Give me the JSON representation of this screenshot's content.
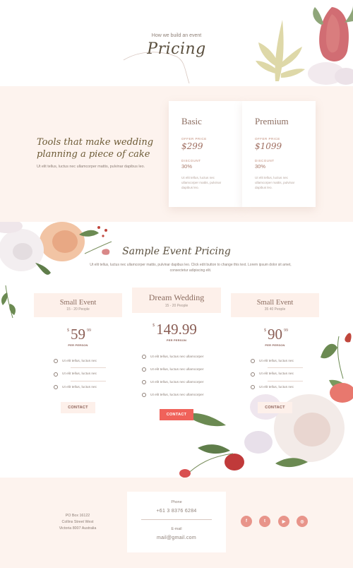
{
  "hero": {
    "kicker": "How we build an event",
    "title": "Pricing"
  },
  "tools": {
    "title": "Tools that make wedding planning a piece of cake",
    "description": "Ut elit tellus, luctus nec ullamcorper mattis, pulvinar dapibus leo."
  },
  "cards": [
    {
      "title": "Basic",
      "offer_label": "OFFER PRICE",
      "price": "$299",
      "discount_label": "DISCOUNT",
      "discount": "30%",
      "description": "Ut elit tellus, luctus nec ullamcorper mattis, pulvinar dapibus leo."
    },
    {
      "title": "Premium",
      "offer_label": "OFFER PRICE",
      "price": "$1099",
      "discount_label": "DISCOUNT",
      "discount": "30%",
      "description": "Ut elit tellus, luctus nec ullamcorper mattis, pulvinar dapibus leo."
    }
  ],
  "sample": {
    "title": "Sample Event Pricing",
    "description": "Ut elit tellus, luctus nec ullamcorper mattis, pulvinar dapibus leo. Click edit button to change this text. Lorem ipsum dolor sit amet, consectetur adipiscing elit."
  },
  "tiers": [
    {
      "name": "Small Event",
      "people": "15 - 20 People",
      "currency": "$",
      "price": "59",
      "cents": "99",
      "per": "PER PERSON",
      "features": [
        "Ut elit tellus, luctus nec",
        "Ut elit tellus, luctus nec",
        "Ut elit tellus, luctus nec"
      ],
      "button": "CONTACT"
    },
    {
      "name": "Dream Wedding",
      "people": "15 - 20 People",
      "currency": "$",
      "price": "149.99",
      "cents": "",
      "per": "PER PERSON",
      "features": [
        "Ut elit tellus, luctus nec ullamcorper",
        "Ut elit tellus, luctus nec ullamcorper",
        "Ut elit tellus, luctus nec ullamcorper",
        "Ut elit tellus, luctus nec ullamcorper"
      ],
      "button": "CONTACT"
    },
    {
      "name": "Small Event",
      "people": "35 40 People",
      "currency": "$",
      "price": "90",
      "cents": "99",
      "per": "PER PERSON",
      "features": [
        "Ut elit tellus, luctus nec",
        "Ut elit tellus, luctus nec",
        "Ut elit tellus, luctus nec"
      ],
      "button": "CONTACT"
    }
  ],
  "footer": {
    "address": [
      "PO Box 16122",
      "Collins Street West",
      "Victoria 8007 Australia"
    ],
    "phone_label": "Phone",
    "phone": "+61 3 8376 6284",
    "email_label": "E-mail",
    "email": "mail@gmail.com",
    "social": [
      {
        "icon": "facebook-icon",
        "glyph": "f"
      },
      {
        "icon": "twitter-icon",
        "glyph": "t"
      },
      {
        "icon": "youtube-icon",
        "glyph": "▶"
      },
      {
        "icon": "instagram-icon",
        "glyph": "◎"
      }
    ]
  },
  "colors": {
    "accent": "#f0625a",
    "brown": "#8a5e55",
    "blush": "#fdf3ee"
  }
}
